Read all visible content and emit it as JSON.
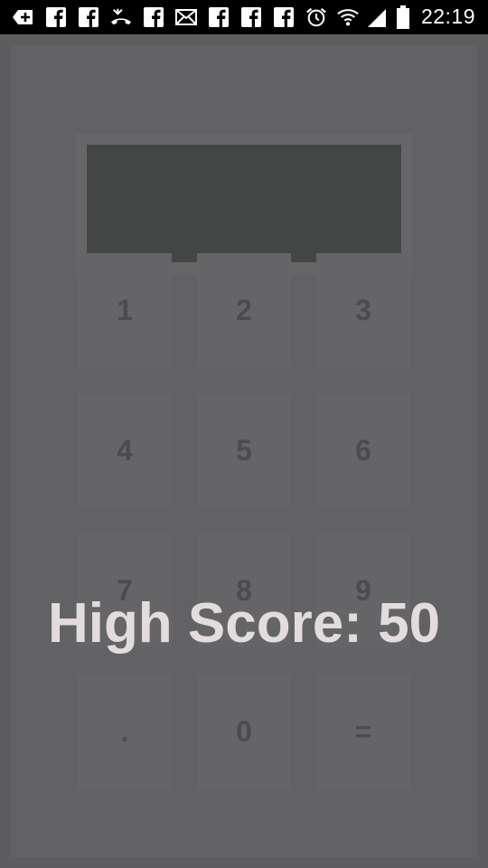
{
  "status_bar": {
    "time": "22:19",
    "icons": [
      "add-notification-icon",
      "facebook-icon",
      "facebook-icon",
      "missed-call-icon",
      "facebook-icon",
      "mail-icon",
      "facebook-icon",
      "facebook-icon",
      "facebook-icon",
      "alarm-icon",
      "wifi-icon",
      "signal-icon",
      "battery-icon"
    ]
  },
  "calculator": {
    "display_value": "",
    "keys": [
      "1",
      "2",
      "3",
      "4",
      "5",
      "6",
      "7",
      "8",
      "9",
      ".",
      "0",
      "="
    ]
  },
  "overlay": {
    "high_score_text": "High Score: 50"
  },
  "colors": {
    "background": "#5f5f61",
    "display": "#444545",
    "key": "#656567",
    "key_text": "#4c4c4e",
    "score_text": "#e2dcde"
  }
}
